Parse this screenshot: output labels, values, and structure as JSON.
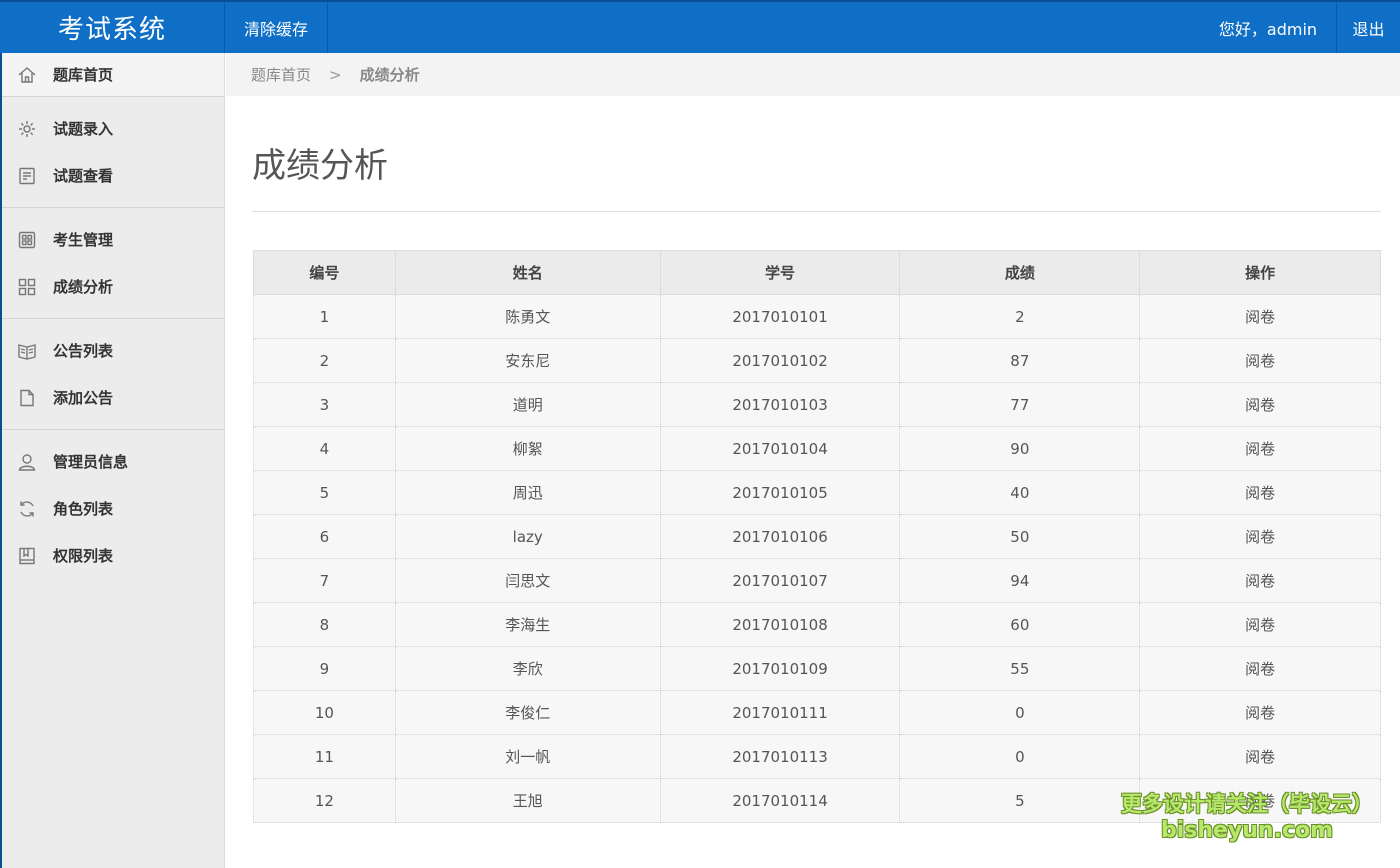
{
  "header": {
    "logo": "考试系统",
    "clear_cache": "清除缓存",
    "greeting": "您好，admin",
    "logout": "退出"
  },
  "sidebar": {
    "groups": [
      [
        {
          "label": "题库首页",
          "icon": "home-icon"
        }
      ],
      [
        {
          "label": "试题录入",
          "icon": "gear-icon"
        },
        {
          "label": "试题查看",
          "icon": "document-icon"
        }
      ],
      [
        {
          "label": "考生管理",
          "icon": "grid-icon"
        },
        {
          "label": "成绩分析",
          "icon": "tiles-icon"
        }
      ],
      [
        {
          "label": "公告列表",
          "icon": "book-icon"
        },
        {
          "label": "添加公告",
          "icon": "file-icon"
        }
      ],
      [
        {
          "label": "管理员信息",
          "icon": "user-icon"
        },
        {
          "label": "角色列表",
          "icon": "refresh-icon"
        },
        {
          "label": "权限列表",
          "icon": "notebook-icon"
        }
      ]
    ]
  },
  "breadcrumb": {
    "root": "题库首页",
    "separator": ">",
    "current": "成绩分析"
  },
  "main": {
    "title": "成绩分析",
    "table": {
      "columns": [
        "编号",
        "姓名",
        "学号",
        "成绩",
        "操作"
      ],
      "rows": [
        [
          "1",
          "陈勇文",
          "2017010101",
          "2",
          "阅卷"
        ],
        [
          "2",
          "安东尼",
          "2017010102",
          "87",
          "阅卷"
        ],
        [
          "3",
          "道明",
          "2017010103",
          "77",
          "阅卷"
        ],
        [
          "4",
          "柳絮",
          "2017010104",
          "90",
          "阅卷"
        ],
        [
          "5",
          "周迅",
          "2017010105",
          "40",
          "阅卷"
        ],
        [
          "6",
          "lazy",
          "2017010106",
          "50",
          "阅卷"
        ],
        [
          "7",
          "闫思文",
          "2017010107",
          "94",
          "阅卷"
        ],
        [
          "8",
          "李海生",
          "2017010108",
          "60",
          "阅卷"
        ],
        [
          "9",
          "李欣",
          "2017010109",
          "55",
          "阅卷"
        ],
        [
          "10",
          "李俊仁",
          "2017010111",
          "0",
          "阅卷"
        ],
        [
          "11",
          "刘一帆",
          "2017010113",
          "0",
          "阅卷"
        ],
        [
          "12",
          "王旭",
          "2017010114",
          "5",
          "阅卷"
        ]
      ]
    }
  },
  "watermark": {
    "line1": "更多设计请关注（毕设云）",
    "line2": "bisheyun.com"
  }
}
